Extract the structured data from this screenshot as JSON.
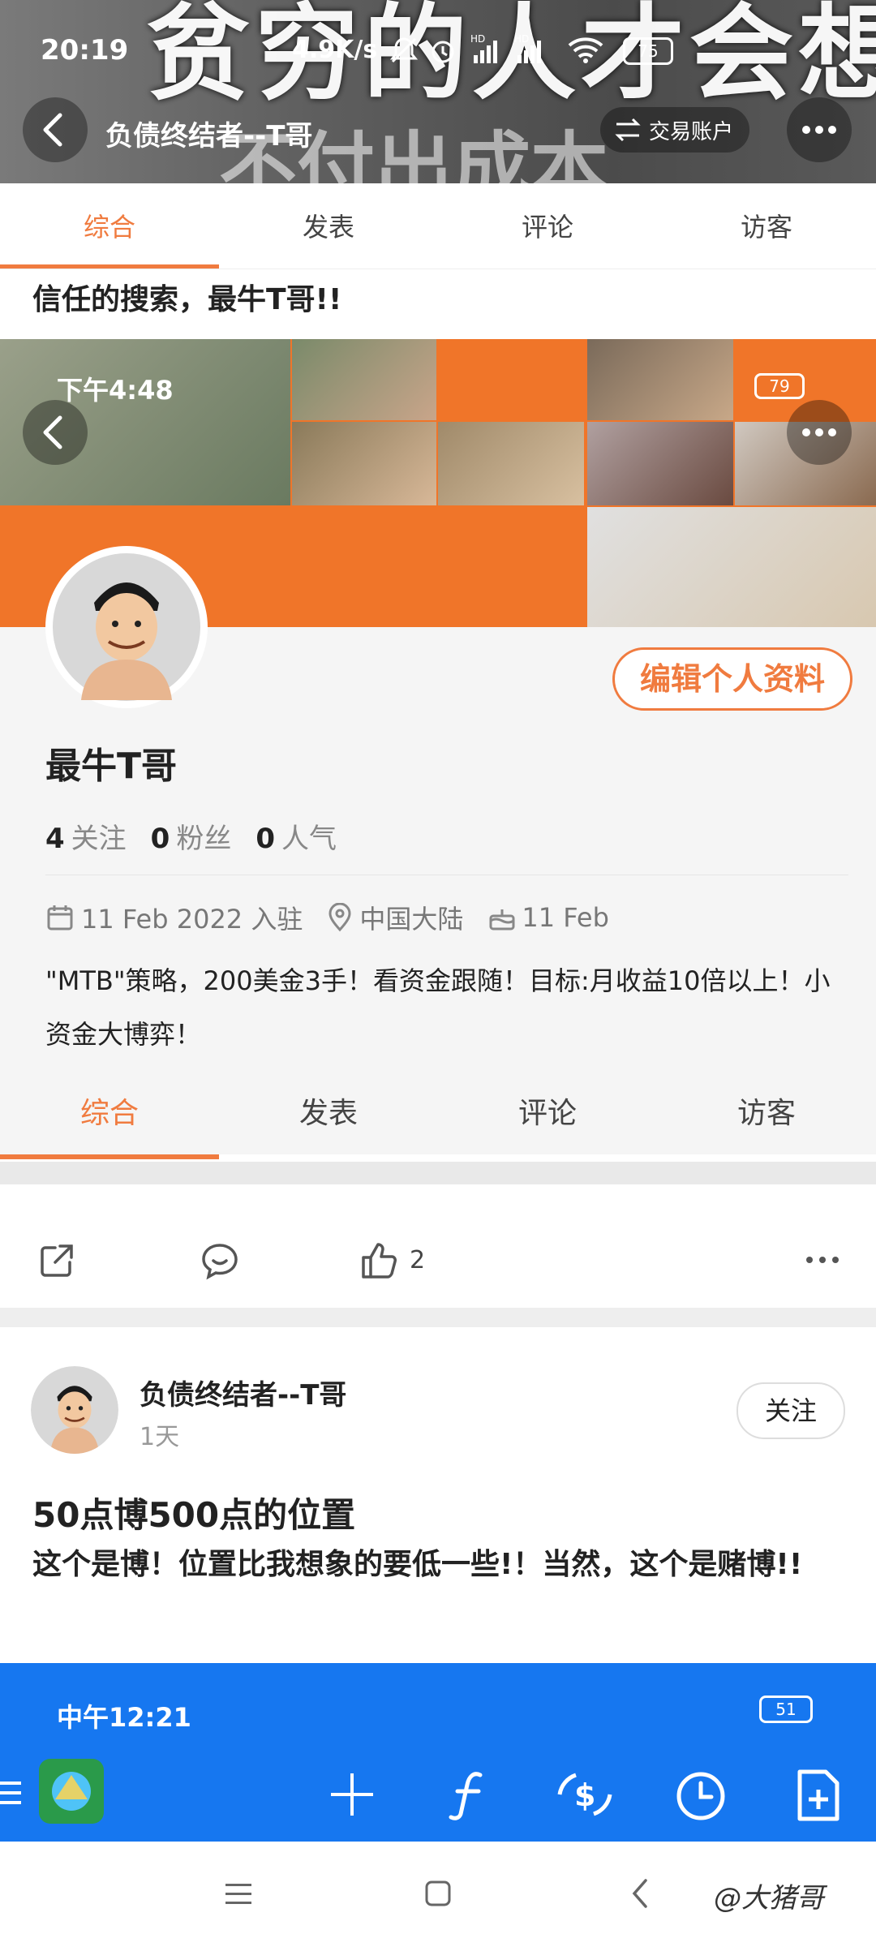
{
  "status_bar": {
    "time": "20:19",
    "speed": "4.9K/s",
    "battery": "75"
  },
  "header": {
    "back_label": "返回",
    "title": "负债终结者--T哥",
    "account_btn": "交易账户"
  },
  "tabs": [
    "综合",
    "发表",
    "评论",
    "访客"
  ],
  "search_line": "信任的搜索，最牛T哥!!",
  "embedded": {
    "status_time": "下午4:48",
    "battery": "79",
    "edit_profile": "编辑个人资料",
    "username": "最牛T哥",
    "stats": [
      {
        "num": "4",
        "label": "关注"
      },
      {
        "num": "0",
        "label": "粉丝"
      },
      {
        "num": "0",
        "label": "人气"
      }
    ],
    "join_date": "11 Feb 2022 入驻",
    "location": "中国大陆",
    "birthday": "11 Feb",
    "bio": "\"MTB\"策略，200美金3手！看资金跟随！目标:月收益10倍以上！小资金大博弈！",
    "tabs": [
      "综合",
      "发表",
      "评论",
      "访客"
    ]
  },
  "actions": {
    "like_count": "2"
  },
  "post": {
    "author": "负债终结者--T哥",
    "time": "1天",
    "follow_btn": "关注",
    "title": "50点博500点的位置",
    "body": "这个是博！位置比我想象的要低一些!！当然，这个是赌博!!"
  },
  "blue_bar": {
    "time": "中午12:21",
    "battery": "51"
  },
  "watermark": "@大猪哥",
  "colors": {
    "accent": "#f07b3f",
    "blue": "#1677f0",
    "banner": "#f07529"
  }
}
